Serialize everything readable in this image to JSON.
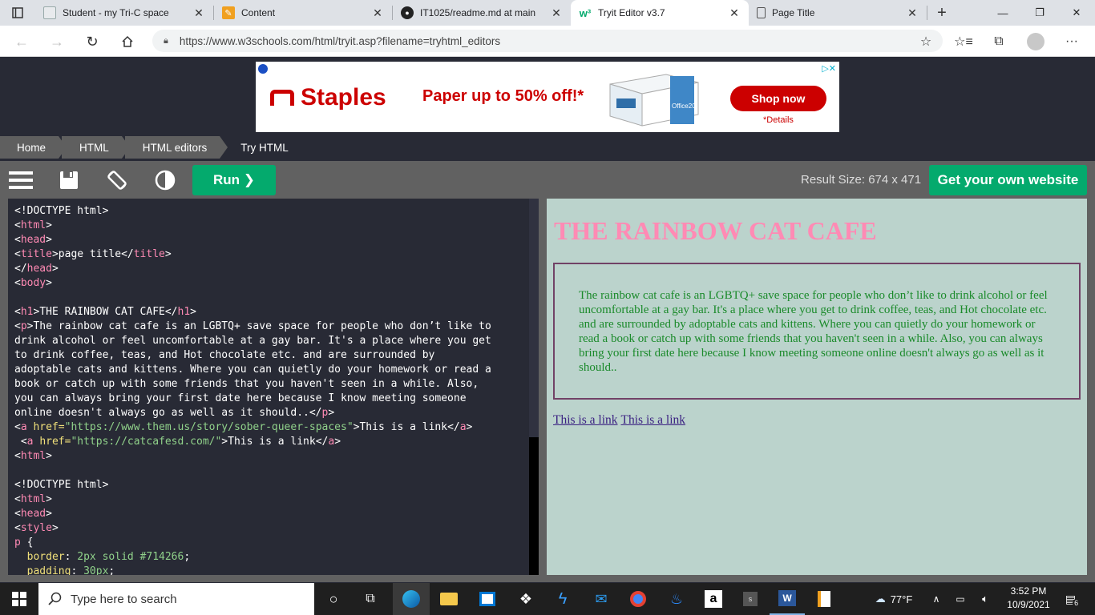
{
  "browser": {
    "tabs": [
      {
        "title": "Student - my Tri-C space",
        "active": false
      },
      {
        "title": "Content",
        "active": false
      },
      {
        "title": "IT1025/readme.md at main",
        "active": false
      },
      {
        "title": "Tryit Editor v3.7",
        "active": true
      },
      {
        "title": "Page Title",
        "active": false
      }
    ],
    "url": "https://www.w3schools.com/html/tryit.asp?filename=tryhtml_editors"
  },
  "ad": {
    "brand": "Staples",
    "headline": "Paper up to 50% off!*",
    "cta": "Shop now",
    "details": "*Details",
    "product_label": "Office20"
  },
  "breadcrumb": [
    "Home",
    "HTML",
    "HTML editors",
    "Try HTML"
  ],
  "toolbar": {
    "run_label": "Run ❯",
    "result_size": "Result Size: 674 x 471",
    "get_website": "Get your own website"
  },
  "code_lines": [
    [
      [
        "t",
        "<!DOCTYPE html>"
      ]
    ],
    [
      [
        "t",
        "<"
      ],
      [
        "g",
        "html"
      ],
      [
        "t",
        ">"
      ]
    ],
    [
      [
        "t",
        "<"
      ],
      [
        "g",
        "head"
      ],
      [
        "t",
        ">"
      ]
    ],
    [
      [
        "t",
        "<"
      ],
      [
        "g",
        "title"
      ],
      [
        "t",
        ">"
      ],
      [
        "w",
        "page title"
      ],
      [
        "t",
        "</"
      ],
      [
        "g",
        "title"
      ],
      [
        "t",
        ">"
      ]
    ],
    [
      [
        "t",
        "</"
      ],
      [
        "g",
        "head"
      ],
      [
        "t",
        ">"
      ]
    ],
    [
      [
        "t",
        "<"
      ],
      [
        "g",
        "body"
      ],
      [
        "t",
        ">"
      ]
    ],
    [],
    [
      [
        "t",
        "<"
      ],
      [
        "g",
        "h1"
      ],
      [
        "t",
        ">"
      ],
      [
        "w",
        "THE RAINBOW CAT CAFE"
      ],
      [
        "t",
        "</"
      ],
      [
        "g",
        "h1"
      ],
      [
        "t",
        ">"
      ]
    ],
    [
      [
        "t",
        "<"
      ],
      [
        "g",
        "p"
      ],
      [
        "t",
        ">"
      ],
      [
        "w",
        "The rainbow cat cafe is an LGBTQ+ save space for people who don’t like to"
      ]
    ],
    [
      [
        "w",
        "drink alcohol or feel uncomfortable at a gay bar. It's a place where you get"
      ]
    ],
    [
      [
        "w",
        "to drink coffee, teas, and Hot chocolate etc. and are surrounded by"
      ]
    ],
    [
      [
        "w",
        "adoptable cats and kittens. Where you can quietly do your homework or read a"
      ]
    ],
    [
      [
        "w",
        "book or catch up with some friends that you haven't seen in a while. Also,"
      ]
    ],
    [
      [
        "w",
        "you can always bring your first date here because I know meeting someone"
      ]
    ],
    [
      [
        "w",
        "online doesn't always go as well as it should.."
      ],
      [
        "t",
        "</"
      ],
      [
        "g",
        "p"
      ],
      [
        "t",
        ">"
      ]
    ],
    [
      [
        "t",
        "<"
      ],
      [
        "g",
        "a "
      ],
      [
        "a",
        "href="
      ],
      [
        "s",
        "\"https://www.them.us/story/sober-queer-spaces\""
      ],
      [
        "t",
        ">"
      ],
      [
        "w",
        "This is a link"
      ],
      [
        "t",
        "</"
      ],
      [
        "g",
        "a"
      ],
      [
        "t",
        ">"
      ]
    ],
    [
      [
        "w",
        " "
      ],
      [
        "t",
        "<"
      ],
      [
        "g",
        "a "
      ],
      [
        "a",
        "href="
      ],
      [
        "s",
        "\"https://catcafesd.com/\""
      ],
      [
        "t",
        ">"
      ],
      [
        "w",
        "This is a link"
      ],
      [
        "t",
        "</"
      ],
      [
        "g",
        "a"
      ],
      [
        "t",
        ">"
      ]
    ],
    [
      [
        "t",
        "<"
      ],
      [
        "g",
        "html"
      ],
      [
        "t",
        ">"
      ]
    ],
    [],
    [
      [
        "t",
        "<!DOCTYPE html>"
      ]
    ],
    [
      [
        "t",
        "<"
      ],
      [
        "g",
        "html"
      ],
      [
        "t",
        ">"
      ]
    ],
    [
      [
        "t",
        "<"
      ],
      [
        "g",
        "head"
      ],
      [
        "t",
        ">"
      ]
    ],
    [
      [
        "t",
        "<"
      ],
      [
        "g",
        "style"
      ],
      [
        "t",
        ">"
      ]
    ],
    [
      [
        "g",
        "p "
      ],
      [
        "w",
        "{"
      ]
    ],
    [
      [
        "w",
        "  "
      ],
      [
        "a",
        "border"
      ],
      [
        "w",
        ": "
      ],
      [
        "s",
        "2px solid #714266"
      ],
      [
        "w",
        ";"
      ]
    ],
    [
      [
        "w",
        "  "
      ],
      [
        "a",
        "padding"
      ],
      [
        "w",
        ": "
      ],
      [
        "s",
        "30px"
      ],
      [
        "w",
        ";"
      ]
    ]
  ],
  "result": {
    "heading": "THE RAINBOW CAT CAFE",
    "paragraph": "The rainbow cat cafe is an LGBTQ+ save space for people who don’t like to drink alcohol or feel uncomfortable at a gay bar. It's a place where you get to drink coffee, teas, and Hot chocolate etc. and are surrounded by adoptable cats and kittens. Where you can quietly do your homework or read a book or catch up with some friends that you haven't seen in a while. Also, you can always bring your first date here because I know meeting someone online doesn't always go as well as it should..",
    "link1": "This is a link",
    "link2": "This is a link"
  },
  "taskbar": {
    "search_placeholder": "Type here to search",
    "weather": "77°F",
    "time": "3:52 PM",
    "date": "10/9/2021",
    "notifications": "6"
  },
  "colors": {
    "w3_green": "#04aa6d",
    "editor_bg": "#282a35",
    "result_bg": "#bbd3cc",
    "heading_pink": "#ff8ab4",
    "para_green": "#1a8a2a",
    "border_purple": "#714266",
    "tag_pink": "#ff8ab4",
    "attr_yellow": "#f0e07a",
    "string_green": "#90d18a",
    "ad_red": "#cc0000"
  }
}
